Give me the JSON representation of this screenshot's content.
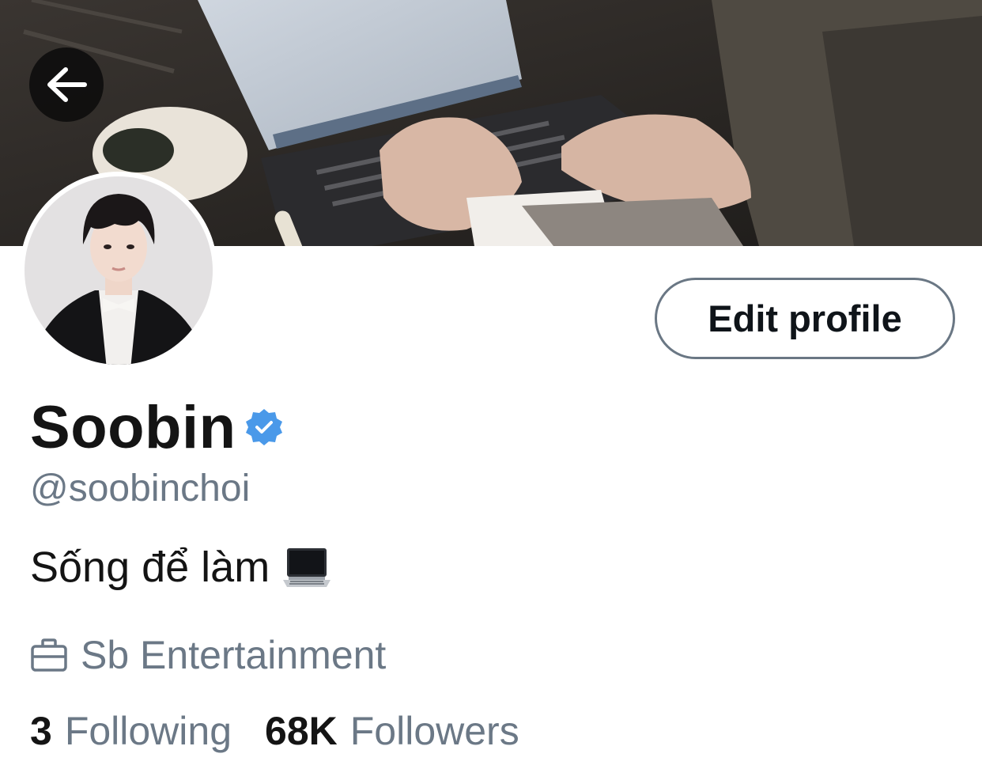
{
  "profile": {
    "display_name": "Soobin",
    "verified": true,
    "handle": "@soobinchoi",
    "bio_text": "Sống để làm",
    "bio_emoji": "laptop-emoji",
    "work": "Sb Entertainment",
    "work_icon": "briefcase-icon"
  },
  "header": {
    "back_icon": "arrow-left-icon"
  },
  "actions": {
    "edit_profile_label": "Edit profile"
  },
  "stats": {
    "following_count": "3",
    "following_label": "Following",
    "followers_count": "68K",
    "followers_label": "Followers"
  },
  "colors": {
    "verified_blue": "#4a99e9",
    "secondary_text": "#6b7886",
    "primary_text": "#141414",
    "button_border": "#6a7784"
  }
}
